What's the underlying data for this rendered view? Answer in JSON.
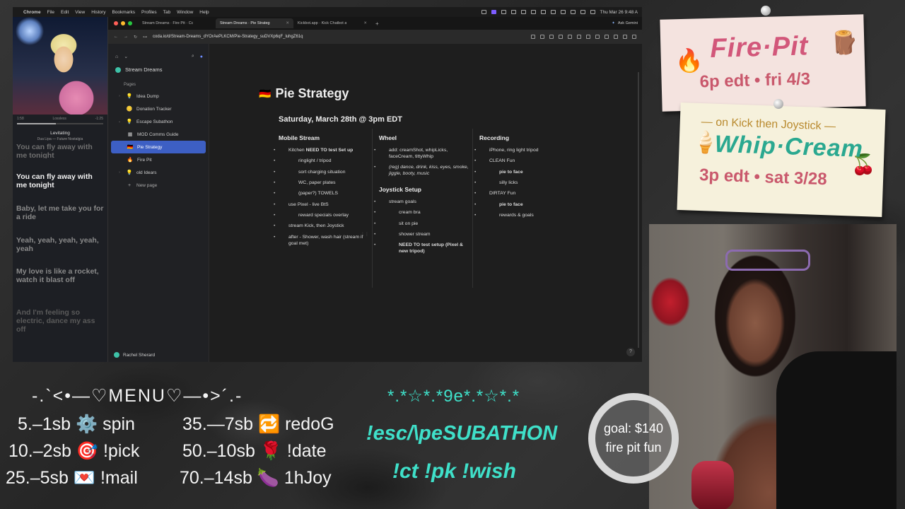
{
  "mac_menu": {
    "items": [
      "Chrome",
      "File",
      "Edit",
      "View",
      "History",
      "Bookmarks",
      "Profiles",
      "Tab",
      "Window",
      "Help"
    ],
    "clock": "Thu Mar 26  9:48 A"
  },
  "player": {
    "time_elapsed": "1:58",
    "quality": "Lossless",
    "time_left": "-1:25",
    "song": "Levitating",
    "artist": "Dua Lipa — Future Nostalgia",
    "lyrics": [
      {
        "text": "You can fly away with me tonight",
        "state": "faded"
      },
      {
        "text": "You can fly away with me tonight",
        "state": "current"
      },
      {
        "text": "Baby, let me take you for a ride",
        "state": "next"
      },
      {
        "text": "Yeah, yeah, yeah, yeah, yeah",
        "state": "next"
      },
      {
        "text": "My love is like a rocket, watch it blast off",
        "state": "next"
      },
      {
        "text": "And I'm feeling so electric, dance my ass off",
        "state": "faded"
      }
    ]
  },
  "browser": {
    "tabs": [
      {
        "label": "Stream Dreams · Fire Pit · Cc",
        "active": false
      },
      {
        "label": "Stream Dreams · Pie Strateg",
        "active": true
      },
      {
        "label": "Kickbot.app · Kick Chatbot a",
        "active": false
      }
    ],
    "ask_gemini": "Ask Gemini",
    "url": "coda.io/d/Stream-Dreams_dYOrAePLKCM/Pie-Strategy_suDVXp6qF_luhgZ61q"
  },
  "sidebar": {
    "doc_title": "Stream Dreams",
    "pages_heading": "Pages",
    "pages": [
      {
        "label": "Idea Dump",
        "emoji": "💡",
        "level": 1,
        "caret": "›",
        "selected": false
      },
      {
        "label": "Donation Tracker",
        "emoji": "🪙",
        "level": 1,
        "caret": "",
        "selected": false
      },
      {
        "label": "Escape Subathon",
        "emoji": "💡",
        "level": 1,
        "caret": "⌄",
        "selected": false
      },
      {
        "label": "MOD Comms Guide",
        "emoji": "▦",
        "level": 2,
        "caret": "",
        "selected": false
      },
      {
        "label": "Pie Strategy",
        "emoji": "🇩🇪",
        "level": 2,
        "caret": "",
        "selected": true
      },
      {
        "label": "Fire Pit",
        "emoji": "🔥",
        "level": 2,
        "caret": "",
        "selected": false
      },
      {
        "label": "old Idears",
        "emoji": "💡",
        "level": 1,
        "caret": "›",
        "selected": false
      }
    ],
    "new_page": "New page",
    "user": "Rachel Sherard"
  },
  "doc": {
    "title": "Pie Strategy",
    "title_emoji": "🇩🇪",
    "subtitle": "Saturday, March 28th @ 3pm EDT",
    "columns": [
      {
        "heading": "Mobile Stream",
        "items": [
          {
            "level": 1,
            "parts": [
              {
                "t": "Kitchen "
              },
              {
                "t": "NEED TO test Set up",
                "b": true
              }
            ]
          },
          {
            "level": 2,
            "parts": [
              {
                "t": "ringlight / tripod"
              }
            ]
          },
          {
            "level": 2,
            "parts": [
              {
                "t": "sort charging situation"
              }
            ]
          },
          {
            "level": 2,
            "parts": [
              {
                "t": "WC, paper plates"
              }
            ]
          },
          {
            "level": 2,
            "parts": [
              {
                "t": "(paper?) TOWELS"
              }
            ]
          },
          {
            "level": 1,
            "parts": [
              {
                "t": "use Pixel - live BtS"
              }
            ]
          },
          {
            "level": 2,
            "parts": [
              {
                "t": "reward specials overlay"
              }
            ]
          },
          {
            "level": 1,
            "parts": [
              {
                "t": "stream Kick, then Joystick"
              }
            ]
          },
          {
            "level": 1,
            "parts": [
              {
                "t": "after - Shower, wash hair (stream if goal met)"
              }
            ]
          }
        ]
      },
      {
        "heading": "Wheel",
        "items": [
          {
            "level": 1,
            "parts": [
              {
                "t": "add: creamShot, whipLicks, faceCream, tittyWhip"
              }
            ]
          },
          {
            "level": 1,
            "parts": [
              {
                "t": "(reg) dance, drink, kiss, eyes, smoke, jiggle, booty, music",
                "i": true
              }
            ]
          }
        ],
        "heading2": "Joystick Setup",
        "items2": [
          {
            "level": 1,
            "parts": [
              {
                "t": "stream goals"
              }
            ]
          },
          {
            "level": 2,
            "parts": [
              {
                "t": "cream bra"
              }
            ]
          },
          {
            "level": 2,
            "parts": [
              {
                "t": "sit on pie"
              }
            ]
          },
          {
            "level": 2,
            "parts": [
              {
                "t": "shower stream"
              }
            ]
          },
          {
            "level": 2,
            "parts": [
              {
                "t": "NEED TO test setup (Pixel & new tripod)",
                "b": true
              }
            ]
          }
        ]
      },
      {
        "heading": "Recording",
        "items": [
          {
            "level": 1,
            "parts": [
              {
                "t": "iPhone, ring light tripod"
              }
            ]
          },
          {
            "level": 1,
            "parts": [
              {
                "t": "CLEAN Fun"
              }
            ]
          },
          {
            "level": 2,
            "parts": [
              {
                "t": "pie to face",
                "b": true
              }
            ]
          },
          {
            "level": 2,
            "parts": [
              {
                "t": "silly licks"
              }
            ]
          },
          {
            "level": 1,
            "parts": [
              {
                "t": "DIRTAY Fun"
              }
            ]
          },
          {
            "level": 2,
            "parts": [
              {
                "t": "pie to face",
                "b": true
              }
            ]
          },
          {
            "level": 2,
            "parts": [
              {
                "t": "rewards & goals"
              }
            ]
          }
        ]
      }
    ]
  },
  "stickers": {
    "fire_pit": {
      "title": "Fire·Pit",
      "when": "6p edt • fri 4/3"
    },
    "whip_cream": {
      "on": "— on Kick then Joystick —",
      "title": "Whip·Cream",
      "when": "3p edt • sat 3/28"
    }
  },
  "overlay": {
    "menu_heading": "-.`<•—♡MENU♡—•>´.-",
    "menu_left": [
      "5.–1sb ⚙️ spin",
      "10.–2sb 🎯 !pick",
      "25.–5sb 💌 !mail"
    ],
    "menu_right": [
      "35.—7sb 🔁 redoG",
      "50.–10sb 🌹 !date",
      "70.–14sb 🍆 1hJoy"
    ],
    "stars": "*.*☆*.*9e*.*☆*.*",
    "subathon": "!esc/\\peSUBATHON",
    "commands": "!ct !pk !wish",
    "goal_line1": "goal: $140",
    "goal_line2": "fire pit fun"
  },
  "colors": {
    "accent_select": "#3d5fc4",
    "teal": "#3fe0c9",
    "coda_green": "#3ec2a8"
  }
}
